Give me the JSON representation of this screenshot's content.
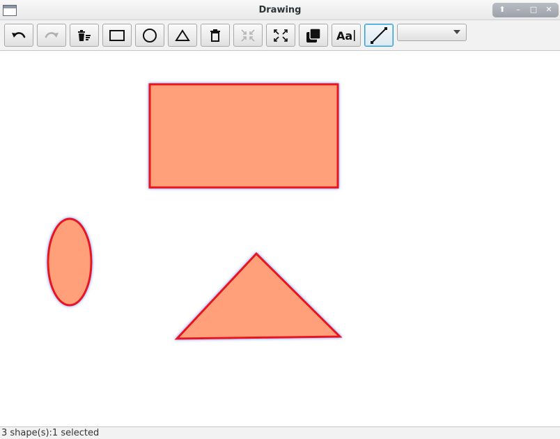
{
  "window": {
    "title": "Drawing",
    "controls": [
      "up-icon",
      "minimize-icon",
      "maximize-icon",
      "close-icon"
    ]
  },
  "toolbar": {
    "buttons": [
      {
        "name": "undo-button",
        "icon": "undo-icon",
        "enabled": true
      },
      {
        "name": "redo-button",
        "icon": "redo-icon",
        "enabled": false
      },
      {
        "name": "clear-all-button",
        "icon": "clear-all-icon",
        "enabled": true
      },
      {
        "name": "rectangle-tool-button",
        "icon": "rectangle-icon",
        "enabled": true
      },
      {
        "name": "ellipse-tool-button",
        "icon": "circle-icon",
        "enabled": true
      },
      {
        "name": "triangle-tool-button",
        "icon": "triangle-icon",
        "enabled": true
      },
      {
        "name": "delete-button",
        "icon": "trash-icon",
        "enabled": true
      },
      {
        "name": "shrink-button",
        "icon": "collapse-arrows-icon",
        "enabled": false
      },
      {
        "name": "expand-button",
        "icon": "expand-arrows-icon",
        "enabled": true
      },
      {
        "name": "bring-to-front-button",
        "icon": "layers-icon",
        "enabled": true
      },
      {
        "name": "text-tool-button",
        "icon": "text-icon",
        "label": "Aa",
        "enabled": true
      },
      {
        "name": "line-tool-button",
        "icon": "line-icon",
        "enabled": true,
        "active": true
      }
    ],
    "combo": {
      "value": ""
    }
  },
  "shapes": {
    "fill": "#ffa07a",
    "stroke": "#e8141e",
    "selection_glow": "#6a8cff",
    "items": [
      {
        "type": "rectangle"
      },
      {
        "type": "ellipse"
      },
      {
        "type": "triangle"
      }
    ]
  },
  "status": {
    "text": "3 shape(s):1 selected"
  }
}
